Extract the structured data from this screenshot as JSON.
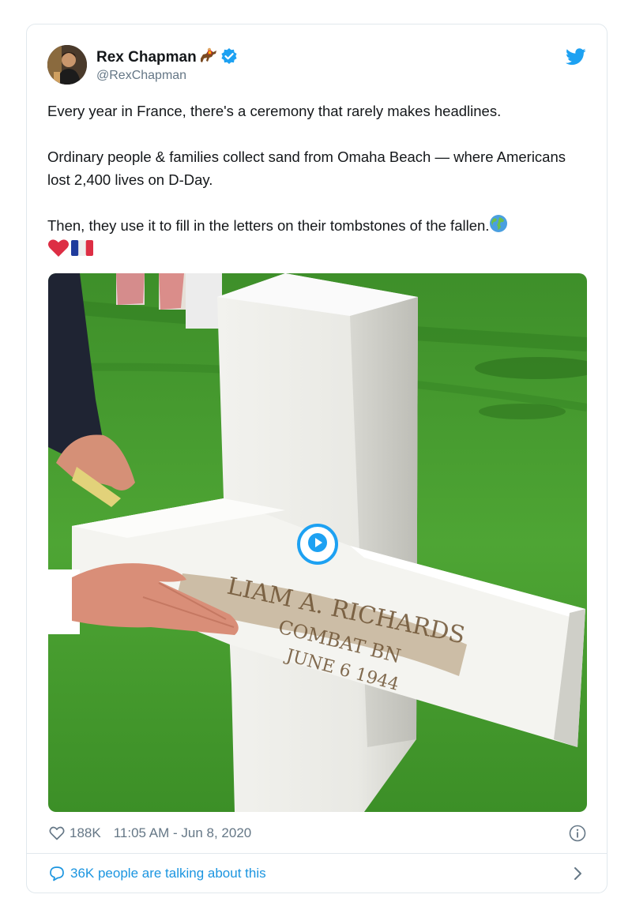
{
  "author": {
    "display_name": "Rex Chapman",
    "handle": "@RexChapman",
    "name_emoji": "horse-racing-emoji",
    "verified": true,
    "avatar": "avatar-photo"
  },
  "icons": {
    "twitter_logo": "twitter-bird-icon",
    "verified_badge": "verified-badge-icon",
    "heart": "heart-outline-icon",
    "info": "info-icon",
    "comment": "speech-bubble-icon",
    "chevron": "chevron-right-icon",
    "play": "play-icon"
  },
  "tweet": {
    "line1": "Every year in France, there's a ceremony that rarely makes headlines.",
    "line2": "Ordinary people & families collect sand from Omaha Beach — where Americans lost 2,400 lives on D-Day.",
    "line3": "Then, they use it to fill in the letters on their tombstones of the fallen.",
    "line3_emoji": "globe-emoji",
    "line4_emojis": [
      "red-heart-emoji",
      "france-flag-emoji"
    ]
  },
  "media": {
    "type": "video",
    "engraving": [
      "LIAM A. RICHARDS",
      "COMBAT BN",
      "JUNE 6 1944"
    ]
  },
  "meta": {
    "likes": "188K",
    "timestamp": "11:05 AM - Jun 8, 2020"
  },
  "conversation": {
    "label": "36K people are talking about this"
  },
  "colors": {
    "brand_blue": "#1da1f2",
    "link_blue": "#1b95e0",
    "secondary_text": "#657786",
    "border": "#e1e8ed"
  }
}
